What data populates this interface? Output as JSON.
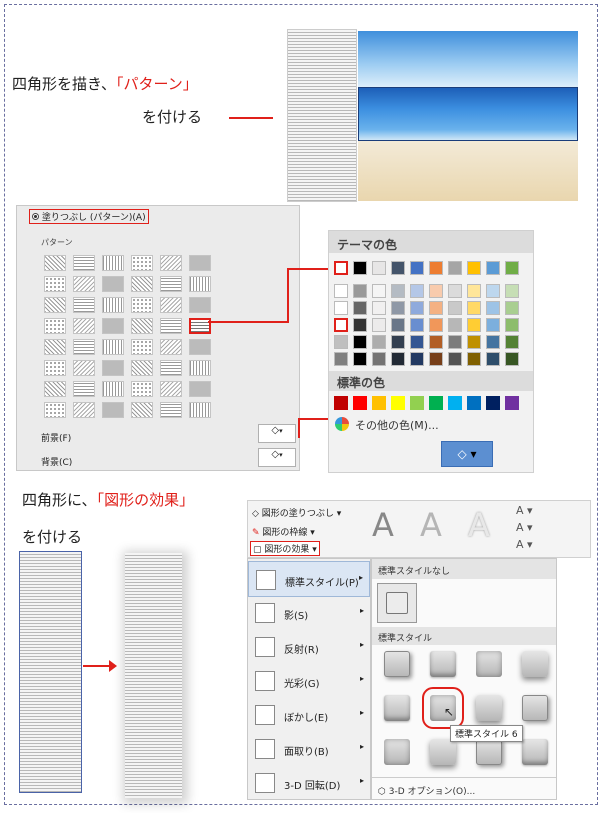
{
  "step1": {
    "line1_prefix": "四角形を描き、",
    "line1_highlight": "「パターン」",
    "line2": "を付ける"
  },
  "step2": {
    "line1_prefix": "四角形に、",
    "line1_highlight": "「図形の効果」",
    "line2": "を付ける"
  },
  "fill_dialog": {
    "radio_label": "塗りつぶし (パターン)(A)",
    "pattern_label": "パターン",
    "foreground_label": "前景(F)",
    "background_label": "背景(C)"
  },
  "color_palette": {
    "theme_heading": "テーマの色",
    "standard_heading": "標準の色",
    "more_colors": "その他の色(M)...",
    "theme_colors": [
      "#ffffff",
      "#000000",
      "#e7e6e6",
      "#44546a",
      "#4472c4",
      "#ed7d31",
      "#a5a5a5",
      "#ffc000",
      "#5b9bd5",
      "#70ad47"
    ],
    "standard_colors": [
      "#c00000",
      "#ff0000",
      "#ffc000",
      "#ffff00",
      "#92d050",
      "#00b050",
      "#00b0f0",
      "#0070c0",
      "#002060",
      "#7030a0"
    ]
  },
  "ribbon": {
    "fill_button": "図形の塗りつぶし",
    "outline_button": "図形の枠線",
    "effects_button": "図形の効果",
    "wordart_letter": "A"
  },
  "effects_menu": {
    "items": [
      "標準スタイル(P)",
      "影(S)",
      "反射(R)",
      "光彩(G)",
      "ぼかし(E)",
      "面取り(B)",
      "3-D 回転(D)"
    ]
  },
  "preset_gallery": {
    "none_heading": "標準スタイルなし",
    "preset_heading": "標準スタイル",
    "tooltip": "標準スタイル 6",
    "options_link": "3-D オプション(O)..."
  }
}
